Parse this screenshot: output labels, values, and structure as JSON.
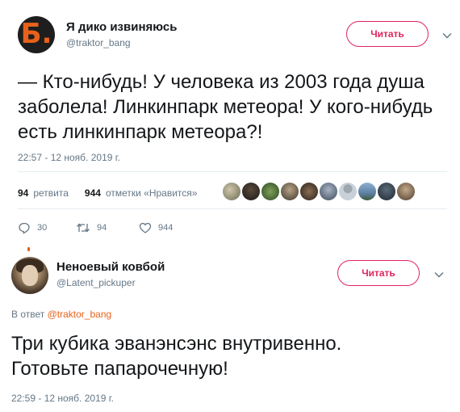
{
  "tweet1": {
    "avatar_letter": "Б.",
    "display_name": "Я дико извиняюсь",
    "handle": "@traktor_bang",
    "follow_label": "Читать",
    "text": "— Кто-нибудь! У человека из 2003 года душа заболела! Линкинпарк метеора! У кого-нибудь есть линкинпарк метеора?!",
    "timestamp": "22:57 - 12 нояб. 2019 г.",
    "retweets_count": "94",
    "retweets_label": "ретвита",
    "likes_count": "944",
    "likes_label": "отметки «Нравится»",
    "reply_count": "30",
    "retweet_count": "94",
    "like_count": "944"
  },
  "tweet2": {
    "display_name": "Неноевый ковбой",
    "handle": "@Latent_pickuper",
    "follow_label": "Читать",
    "reply_prefix": "В ответ",
    "reply_mention": "@traktor_bang",
    "text": "Три кубика эванэнсэнс внутривенно. Готовьте папарочечную!",
    "timestamp": "22:59 - 12 нояб. 2019 г."
  },
  "colors": {
    "accent": "#e0245e",
    "orange": "#e8611a",
    "muted": "#657786",
    "text": "#14171a"
  },
  "icons": [
    "chevron-down-icon",
    "reply-icon",
    "retweet-icon",
    "like-icon"
  ]
}
